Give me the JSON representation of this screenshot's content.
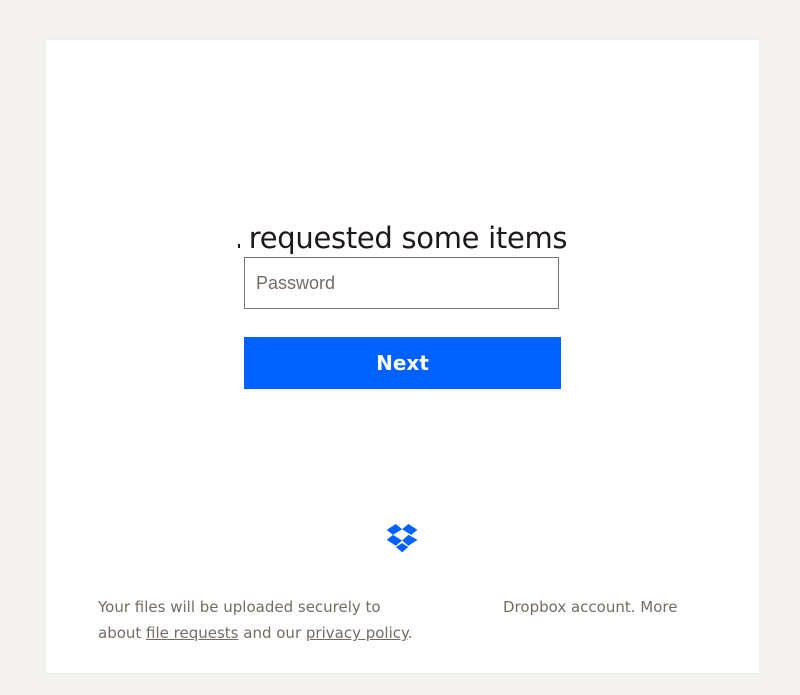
{
  "heading": {
    "text": "requested some items"
  },
  "form": {
    "password_placeholder": "Password",
    "next_label": "Next"
  },
  "footer": {
    "left_line1": "Your files will be uploaded securely to",
    "left_line2_prefix": "about ",
    "file_requests_link": "file requests",
    "left_line2_middle": " and our ",
    "privacy_policy_link": "privacy policy",
    "left_line2_suffix": ".",
    "right_text": "Dropbox account. More"
  },
  "icons": {
    "logo": "dropbox-logo-icon"
  },
  "colors": {
    "background": "#f4f2ee",
    "card": "#ffffff",
    "button": "#0061fe",
    "button_text": "#ffffff",
    "heading_text": "#1e1919",
    "muted_text": "#736c64",
    "input_border": "#7c736e",
    "logo": "#0061fe"
  }
}
